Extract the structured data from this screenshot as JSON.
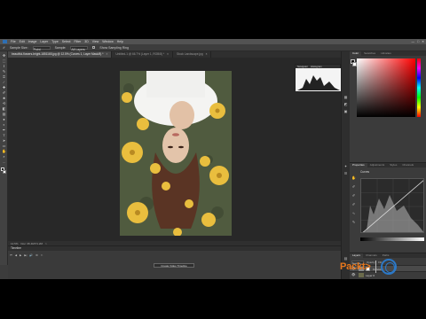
{
  "menubar": {
    "items": [
      "File",
      "Edit",
      "Image",
      "Layer",
      "Type",
      "Select",
      "Filter",
      "3D",
      "View",
      "Window",
      "Help"
    ],
    "window_controls": [
      "—",
      "□",
      "✕"
    ]
  },
  "options_bar": {
    "sample_size_label": "Sample Size:",
    "sample_size_value": "Point Sample",
    "sample_label": "Sample:",
    "sample_value": "All Layers",
    "show_ring_label": "Show Sampling Ring"
  },
  "toolbar": {
    "icons": [
      "move-icon",
      "marquee-icon",
      "lasso-icon",
      "quick-select-icon",
      "crop-icon",
      "eyedropper-icon",
      "healing-brush-icon",
      "brush-icon",
      "clone-stamp-icon",
      "history-brush-icon",
      "eraser-icon",
      "gradient-icon",
      "blur-icon",
      "dodge-icon",
      "pen-icon",
      "type-icon",
      "path-select-icon",
      "shape-icon",
      "hand-icon",
      "zoom-icon",
      "more-tools-icon"
    ],
    "glyphs": [
      "✥",
      "⬚",
      "ℓ",
      "✎",
      "⌗",
      "⁄",
      "✚",
      "✐",
      "♣",
      "⟲",
      "◧",
      "▤",
      "●",
      "◐",
      "✒",
      "T",
      "➤",
      "▭",
      "✋",
      "⌕",
      "…"
    ]
  },
  "tabs": [
    {
      "label": "beautiful-flowers-bright-1851165.jpg @ 12.5% (Curves 1, Layer Mask/8) *",
      "active": true,
      "close": "×"
    },
    {
      "label": "Untitled-1 @ 66.7% (Layer 1, RGB/8) *",
      "active": false,
      "close": "×"
    },
    {
      "label": "Stock Landscape.jpg",
      "active": false,
      "close": "×"
    }
  ],
  "status": {
    "zoom": "12.5%",
    "doc": "Doc: 35.4M/71.2M",
    "arrow": ">"
  },
  "histogram": {
    "tabs": [
      "Navigator",
      "Histogram"
    ]
  },
  "timeline": {
    "title": "Timeline",
    "controls": [
      "⏮",
      "◀",
      "▶",
      "▶|",
      "🔊",
      "⚙",
      "✂"
    ],
    "create_button": "Create Video Timeline"
  },
  "panels": {
    "color_tabs": [
      "Color",
      "Swatches",
      "Libraries"
    ],
    "properties_tabs": [
      "Properties",
      "Adjustments",
      "Styles",
      "Channels"
    ],
    "properties_title": "Curves",
    "curve_tools": [
      "✋",
      "✐",
      "✐",
      "✐",
      "∿",
      "✎"
    ],
    "layers_tabs": [
      "Layers",
      "Channels",
      "Paths"
    ],
    "layer_controls": [
      "Normal",
      "Opacity:",
      "Fill:"
    ],
    "layers": [
      {
        "name": "Curves 1",
        "selected": true,
        "eye": "👁"
      },
      {
        "name": "Layer 0",
        "selected": false,
        "eye": "👁"
      }
    ],
    "right_icons": [
      "▦",
      "◩",
      "▣",
      "✦",
      "☰",
      "▤"
    ]
  },
  "watermark": {
    "brand": "Packt>"
  },
  "colors": {
    "accent_orange": "#e8771c",
    "accent_blue": "#2c78c6",
    "ui_dark": "#282828"
  }
}
